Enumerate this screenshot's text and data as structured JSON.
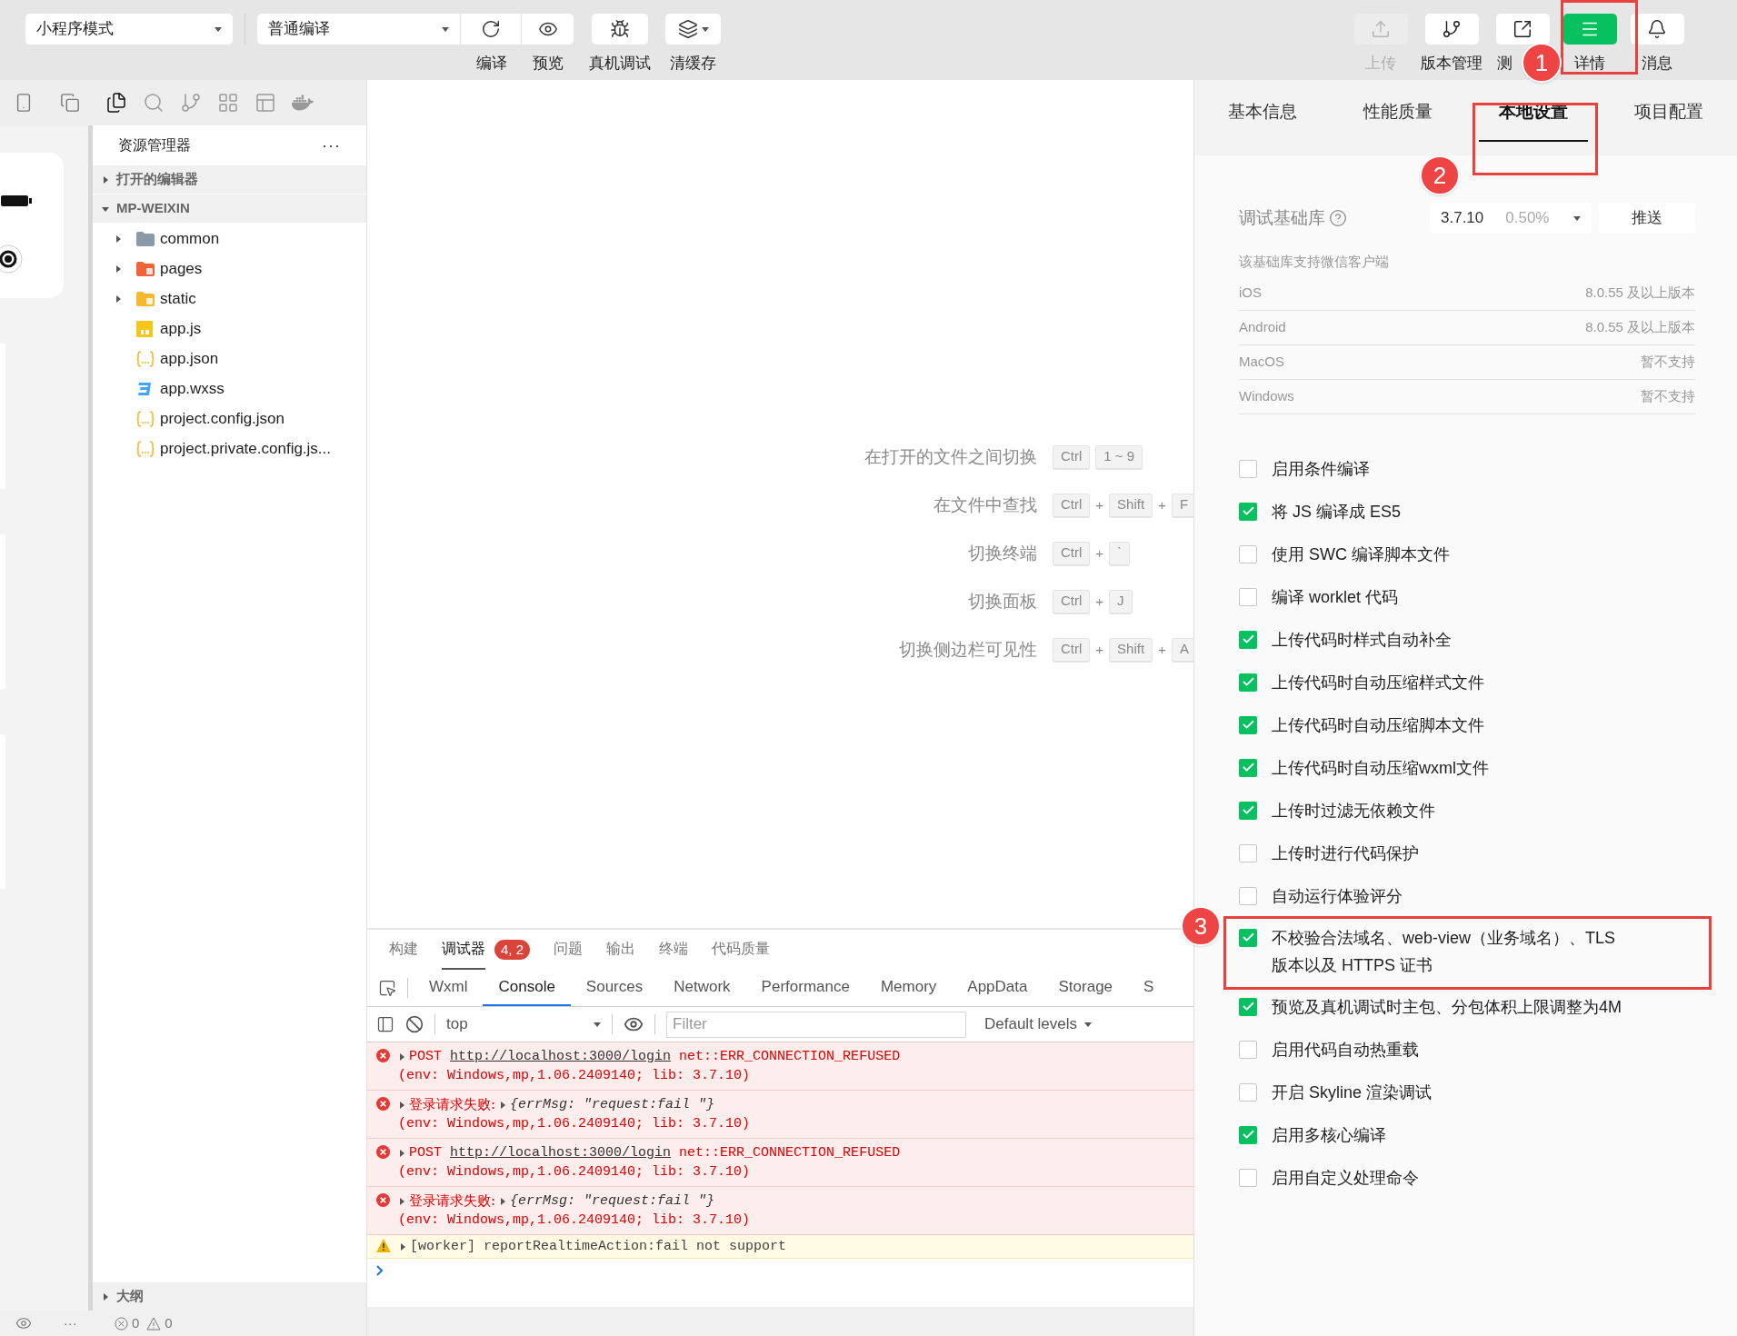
{
  "toolbar": {
    "mode_select": "小程序模式",
    "compile_select": "普通编译",
    "left_tools": [
      {
        "kind": "refresh",
        "label": "编译"
      },
      {
        "kind": "eye",
        "label": "预览"
      },
      {
        "kind": "bug",
        "label": "真机调试"
      },
      {
        "kind": "layers",
        "label": "清缓存"
      }
    ],
    "right_tools": [
      {
        "kind": "upload",
        "label": "上传",
        "disabled": true,
        "active": false
      },
      {
        "kind": "branch",
        "label": "版本管理",
        "disabled": false,
        "active": false
      },
      {
        "kind": "external",
        "label": "测",
        "disabled": false,
        "active": false
      },
      {
        "kind": "menu",
        "label": "详情",
        "disabled": false,
        "active": true
      },
      {
        "kind": "bell",
        "label": "消息",
        "disabled": false,
        "active": false
      }
    ]
  },
  "activity_bar": [
    {
      "kind": "copy",
      "selected": true
    },
    {
      "kind": "search",
      "selected": false
    },
    {
      "kind": "branch",
      "selected": false
    },
    {
      "kind": "blocks",
      "selected": false
    },
    {
      "kind": "layout",
      "selected": false
    },
    {
      "kind": "docker",
      "selected": false
    }
  ],
  "simulator": {
    "more": "···"
  },
  "explorer": {
    "title": "资源管理器",
    "more": "···",
    "outline": "大纲",
    "sections": [
      {
        "label": "打开的编辑器",
        "expanded": false
      },
      {
        "label": "MP-WEIXIN",
        "expanded": true,
        "children": [
          {
            "name": "common",
            "kind": "folder",
            "expanded": false
          },
          {
            "name": "pages",
            "kind": "pagesfolder",
            "expanded": false
          },
          {
            "name": "static",
            "kind": "assetfolder",
            "expanded": false
          },
          {
            "name": "app.js",
            "kind": "js"
          },
          {
            "name": "app.json",
            "kind": "json"
          },
          {
            "name": "app.wxss",
            "kind": "css"
          },
          {
            "name": "project.config.json",
            "kind": "json"
          },
          {
            "name": "project.private.config.js...",
            "kind": "json"
          }
        ]
      }
    ]
  },
  "status_bar": {
    "errors": "0",
    "warnings": "0"
  },
  "shortcuts": [
    {
      "label": "在打开的文件之间切换",
      "keys": [
        {
          "kind": "key",
          "text": "Ctrl"
        },
        {
          "kind": "key",
          "text": "1 ~ 9"
        }
      ]
    },
    {
      "label": "在文件中查找",
      "keys": [
        {
          "kind": "key",
          "text": "Ctrl"
        },
        {
          "kind": "plus",
          "text": "+"
        },
        {
          "kind": "key",
          "text": "Shift"
        },
        {
          "kind": "plus",
          "text": "+"
        },
        {
          "kind": "key",
          "text": "F"
        }
      ]
    },
    {
      "label": "切换终端",
      "keys": [
        {
          "kind": "key",
          "text": "Ctrl"
        },
        {
          "kind": "plus",
          "text": "+"
        },
        {
          "kind": "key",
          "text": "`"
        }
      ]
    },
    {
      "label": "切换面板",
      "keys": [
        {
          "kind": "key",
          "text": "Ctrl"
        },
        {
          "kind": "plus",
          "text": "+"
        },
        {
          "kind": "key",
          "text": "J"
        }
      ]
    },
    {
      "label": "切换侧边栏可见性",
      "keys": [
        {
          "kind": "key",
          "text": "Ctrl"
        },
        {
          "kind": "plus",
          "text": "+"
        },
        {
          "kind": "key",
          "text": "Shift"
        },
        {
          "kind": "plus",
          "text": "+"
        },
        {
          "kind": "key",
          "text": "A"
        }
      ]
    }
  ],
  "devtools": {
    "panel_tabs": [
      {
        "label": "构建",
        "selected": false
      },
      {
        "label": "调试器",
        "selected": true,
        "badge": "4, 2"
      },
      {
        "label": "问题",
        "selected": false
      },
      {
        "label": "输出",
        "selected": false
      },
      {
        "label": "终端",
        "selected": false
      },
      {
        "label": "代码质量",
        "selected": false
      }
    ],
    "tabs": [
      {
        "label": "Wxml",
        "selected": false
      },
      {
        "label": "Console",
        "selected": true
      },
      {
        "label": "Sources",
        "selected": false
      },
      {
        "label": "Network",
        "selected": false
      },
      {
        "label": "Performance",
        "selected": false
      },
      {
        "label": "Memory",
        "selected": false
      },
      {
        "label": "AppData",
        "selected": false
      },
      {
        "label": "Storage",
        "selected": false
      },
      {
        "label": "S",
        "selected": false
      }
    ],
    "context": "top",
    "filter_placeholder": "Filter",
    "levels": "Default levels",
    "logs": [
      {
        "kind": "error",
        "method": "POST",
        "url": "http://localhost:3000/login",
        "error": "net::ERR_CONNECTION_REFUSED",
        "env": "(env: Windows,mp,1.06.2409140; lib: 3.7.10)"
      },
      {
        "kind": "error",
        "text": "登录请求失败:",
        "object": "{errMsg: \"request:fail \"}",
        "env": "(env: Windows,mp,1.06.2409140; lib: 3.7.10)"
      },
      {
        "kind": "error",
        "method": "POST",
        "url": "http://localhost:3000/login",
        "error": "net::ERR_CONNECTION_REFUSED",
        "env": "(env: Windows,mp,1.06.2409140; lib: 3.7.10)"
      },
      {
        "kind": "error",
        "text": "登录请求失败:",
        "object": "{errMsg: \"request:fail \"}",
        "env": "(env: Windows,mp,1.06.2409140; lib: 3.7.10)"
      },
      {
        "kind": "warning",
        "text": "[worker] reportRealtimeAction:fail not support"
      }
    ]
  },
  "details": {
    "tabs": [
      {
        "label": "基本信息",
        "selected": false
      },
      {
        "label": "性能质量",
        "selected": false
      },
      {
        "label": "本地设置",
        "selected": true
      },
      {
        "label": "项目配置",
        "selected": false
      }
    ],
    "sdk_label": "调试基础库",
    "sdk_version": "3.7.10",
    "sdk_share": "0.50%",
    "push": "推送",
    "support_title": "该基础库支持微信客户端",
    "support": [
      {
        "platform": "iOS",
        "version": "8.0.55 及以上版本"
      },
      {
        "platform": "Android",
        "version": "8.0.55 及以上版本"
      },
      {
        "platform": "MacOS",
        "version": "暂不支持"
      },
      {
        "platform": "Windows",
        "version": "暂不支持"
      }
    ],
    "options": [
      {
        "label": "启用条件编译",
        "checked": false,
        "highlighted": false
      },
      {
        "label": "将 JS 编译成 ES5",
        "checked": true,
        "highlighted": false
      },
      {
        "label": "使用 SWC 编译脚本文件",
        "checked": false,
        "highlighted": false
      },
      {
        "label": "编译 worklet 代码",
        "checked": false,
        "highlighted": false
      },
      {
        "label": "上传代码时样式自动补全",
        "checked": true,
        "highlighted": false
      },
      {
        "label": "上传代码时自动压缩样式文件",
        "checked": true,
        "highlighted": false
      },
      {
        "label": "上传代码时自动压缩脚本文件",
        "checked": true,
        "highlighted": false
      },
      {
        "label": "上传代码时自动压缩wxml文件",
        "checked": true,
        "highlighted": false
      },
      {
        "label": "上传时过滤无依赖文件",
        "checked": true,
        "highlighted": false
      },
      {
        "label": "上传时进行代码保护",
        "checked": false,
        "highlighted": false
      },
      {
        "label": "自动运行体验评分",
        "checked": false,
        "highlighted": false
      },
      {
        "label": "不校验合法域名、web-view（业务域名）、TLS 版本以及 HTTPS 证书",
        "checked": true,
        "highlighted": true
      },
      {
        "label": "预览及真机调试时主包、分包体积上限调整为4M",
        "checked": true,
        "highlighted": false
      },
      {
        "label": "启用代码自动热重载",
        "checked": false,
        "highlighted": false
      },
      {
        "label": "开启 Skyline 渲染调试",
        "checked": false,
        "highlighted": false
      },
      {
        "label": "启用多核心编译",
        "checked": true,
        "highlighted": false
      },
      {
        "label": "启用自定义处理命令",
        "checked": false,
        "highlighted": false
      }
    ]
  },
  "annotations": [
    {
      "label": "1"
    },
    {
      "label": "2"
    },
    {
      "label": "3"
    }
  ]
}
